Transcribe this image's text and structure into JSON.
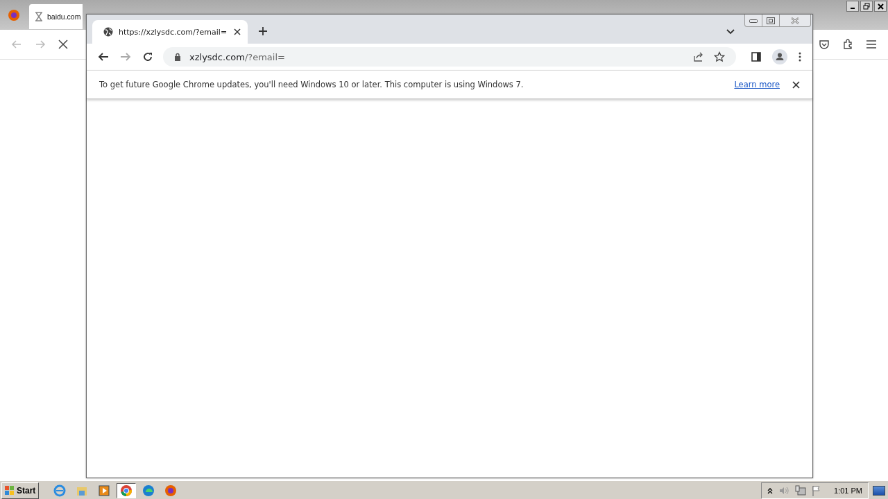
{
  "firefox": {
    "tabs": [
      {
        "title": "baidu.com",
        "selected": true
      }
    ]
  },
  "chrome": {
    "tabs": [
      {
        "title": "https://xzlysdc.com/?email=",
        "selected": true
      }
    ],
    "address": {
      "host": "xzlysdc.com",
      "path": "/?email="
    },
    "infobar": {
      "message": "To get future Google Chrome updates, you'll need Windows 10 or later. This computer is using Windows 7.",
      "link": "Learn more"
    }
  },
  "taskbar": {
    "start": "Start",
    "apps": [
      {
        "kind": "ie",
        "active": false
      },
      {
        "kind": "folder",
        "active": false
      },
      {
        "kind": "media",
        "active": false
      },
      {
        "kind": "chrome",
        "active": true
      },
      {
        "kind": "edge",
        "active": false
      },
      {
        "kind": "firefox",
        "active": false
      }
    ],
    "clock": "1:01 PM"
  }
}
